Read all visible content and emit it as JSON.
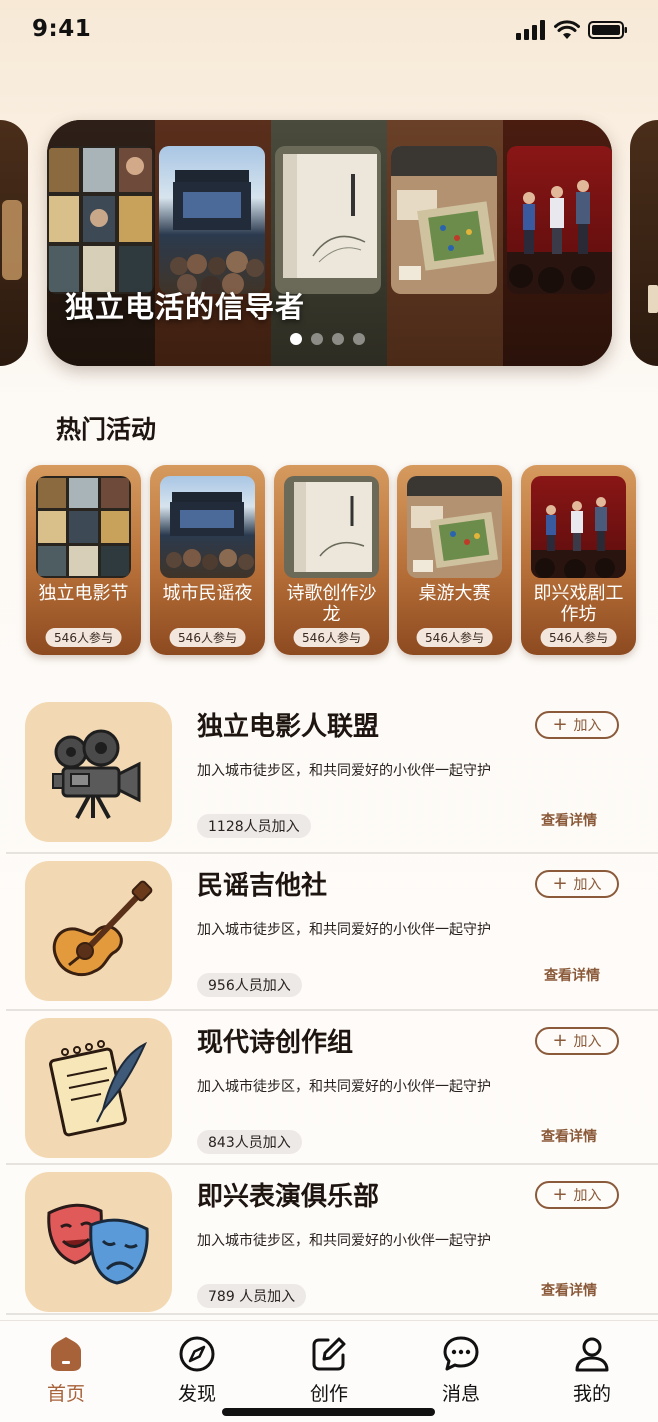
{
  "status_bar": {
    "time": "9:41"
  },
  "hero": {
    "title": "独立电活的信导者",
    "dots": 4,
    "active_dot": 0
  },
  "hot_section": {
    "title": "热门活动",
    "items": [
      {
        "name": "独立电影节",
        "count": "546人参与"
      },
      {
        "name": "城市民谣夜",
        "count": "546人参与"
      },
      {
        "name": "诗歌创作沙龙",
        "count": "546人参与"
      },
      {
        "name": "桌游大赛",
        "count": "546人参与"
      },
      {
        "name": "即兴戏剧工作坊",
        "count": "546人参与"
      }
    ]
  },
  "clubs": [
    {
      "name": "独立电影人联盟",
      "desc": "加入城市徒步区，和共同爱好的小伙伴一起守护",
      "count": "1128人员加入",
      "join": "加入",
      "detail": "查看详情",
      "icon": "movie-camera-icon"
    },
    {
      "name": "民谣吉他社",
      "desc": "加入城市徒步区，和共同爱好的小伙伴一起守护",
      "count": "956人员加入",
      "join": "加入",
      "detail": "查看详情",
      "icon": "guitar-icon"
    },
    {
      "name": "现代诗创作组",
      "desc": "加入城市徒步区，和共同爱好的小伙伴一起守护",
      "count": "843人员加入",
      "join": "加入",
      "detail": "查看详情",
      "icon": "notepad-quill-icon"
    },
    {
      "name": "即兴表演俱乐部",
      "desc": "加入城市徒步区，和共同爱好的小伙伴一起守护",
      "count": "789 人员加入",
      "join": "加入",
      "detail": "查看详情",
      "icon": "theater-masks-icon"
    }
  ],
  "tabbar": {
    "items": [
      {
        "label": "首页",
        "icon": "home-icon",
        "active": true
      },
      {
        "label": "发现",
        "icon": "compass-icon"
      },
      {
        "label": "创作",
        "icon": "edit-icon"
      },
      {
        "label": "消息",
        "icon": "chat-bubble-icon"
      },
      {
        "label": "我的",
        "icon": "user-icon"
      }
    ]
  },
  "colors": {
    "accent": "#a8623a",
    "card_brown": "#b66f38",
    "icon_bg": "#f3d9b3"
  }
}
